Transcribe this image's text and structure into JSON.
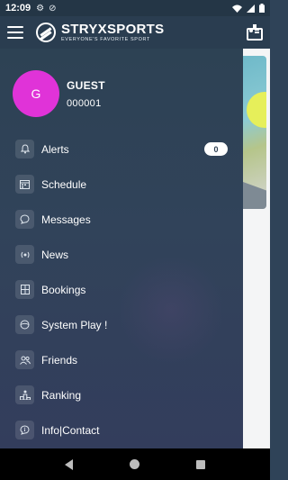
{
  "status_bar": {
    "time": "12:09",
    "icons": [
      "gear-icon",
      "blocked-icon",
      "wifi-icon",
      "signal-icon",
      "battery-icon"
    ]
  },
  "app_bar": {
    "logo_title": "STRYXSPORTS",
    "logo_subtitle": "EVERYONE'S FAVORITE SPORT"
  },
  "profile": {
    "avatar_letter": "G",
    "name": "GUEST",
    "id": "000001",
    "avatar_color": "#e033d8"
  },
  "menu": {
    "items": [
      {
        "label": "Alerts",
        "icon": "bell-icon",
        "badge": "0"
      },
      {
        "label": "Schedule",
        "icon": "calendar-icon"
      },
      {
        "label": "Messages",
        "icon": "chat-icon"
      },
      {
        "label": "News",
        "icon": "broadcast-icon"
      },
      {
        "label": "Bookings",
        "icon": "bookings-icon"
      },
      {
        "label": "System Play !",
        "icon": "ball-icon"
      },
      {
        "label": "Friends",
        "icon": "friends-icon"
      },
      {
        "label": "Ranking",
        "icon": "podium-icon"
      },
      {
        "label": "Info|Contact",
        "icon": "info-chat-icon"
      }
    ]
  },
  "colors": {
    "drawer_bg": "#2f4358",
    "accent_avatar": "#e033d8"
  }
}
